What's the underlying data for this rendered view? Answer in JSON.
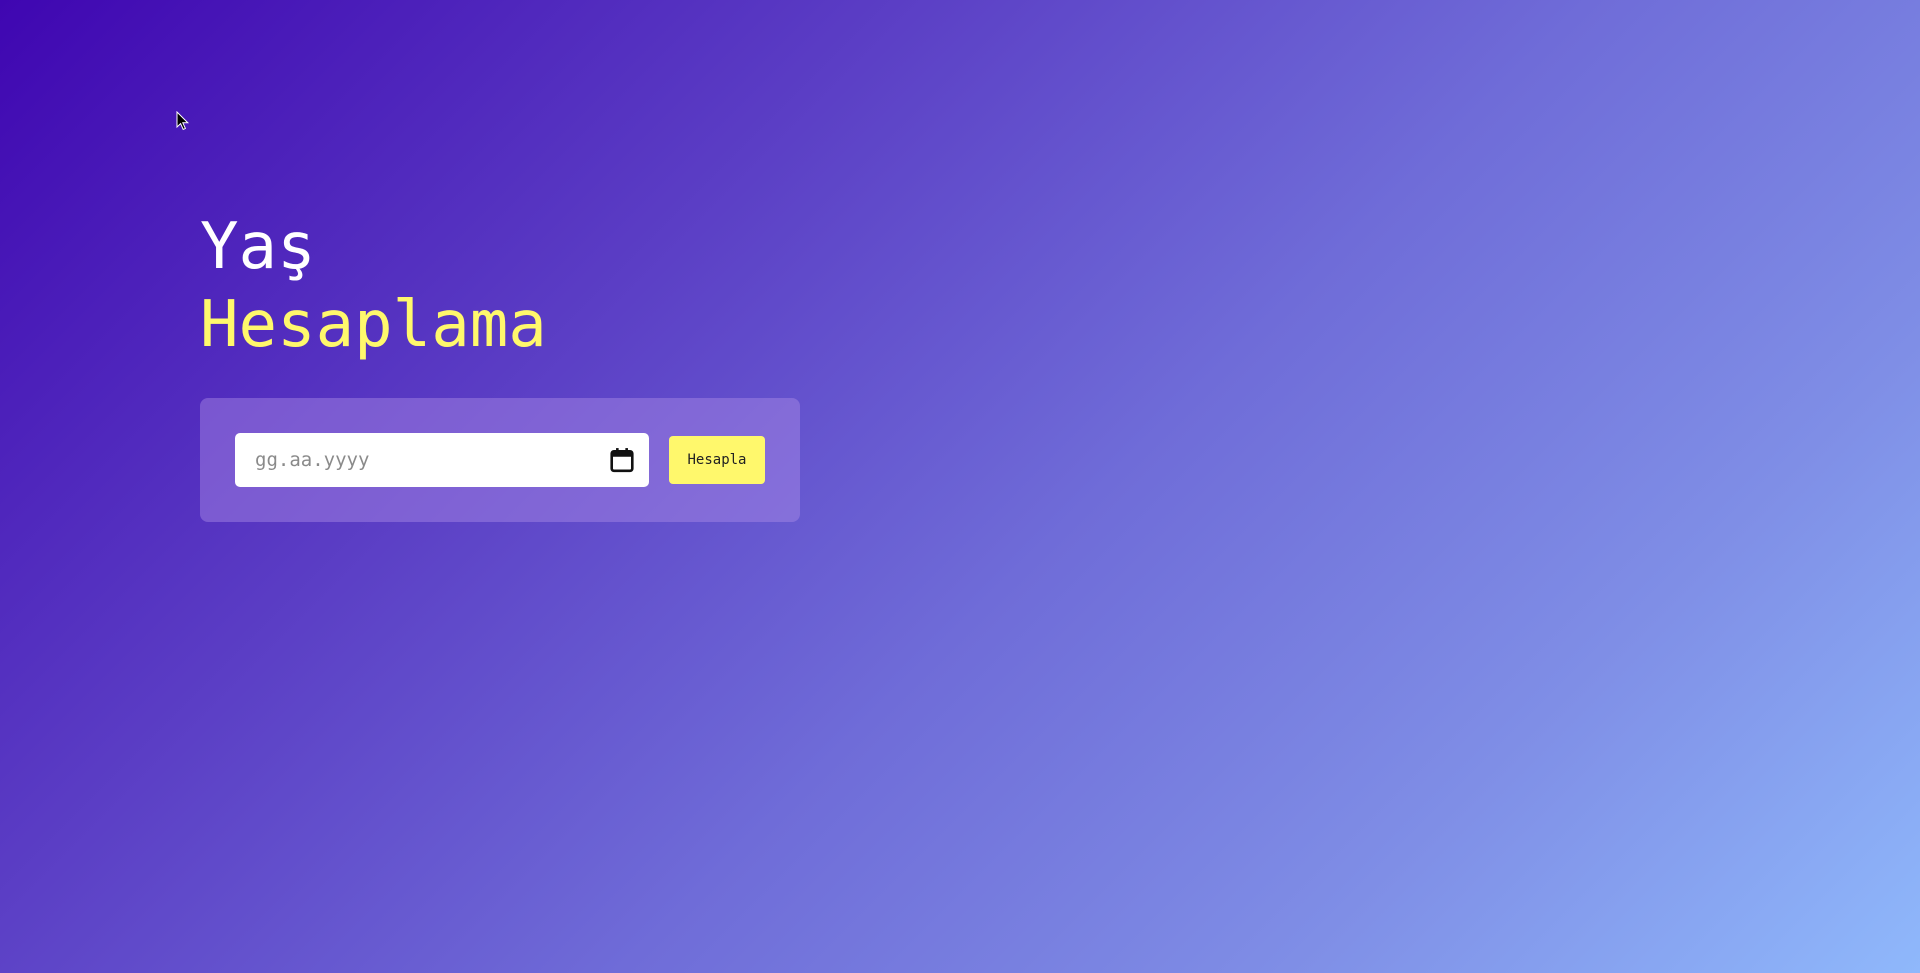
{
  "header": {
    "title_line1": "Yaş",
    "title_line2": "Hesaplama"
  },
  "form": {
    "date_placeholder": "gg.aa.yyyy",
    "date_value": "",
    "calendar_icon": "calendar-icon",
    "submit_label": "Hesapla"
  },
  "colors": {
    "gradient_start": "#3f06b1",
    "gradient_end": "#8fb8fb",
    "accent_yellow": "#fff86c",
    "title_white": "#ffffff"
  }
}
